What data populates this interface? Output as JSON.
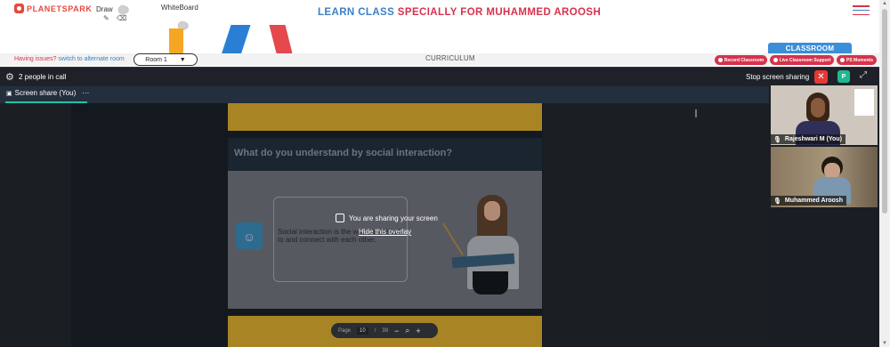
{
  "header": {
    "logo_text": "PLANETSPARK",
    "draw_label": "Draw",
    "whiteboard_label": "WhiteBoard",
    "title_part1": "LEARN CLASS",
    "title_part2": "SPECIALLY FOR MUHAMMED AROOSH"
  },
  "subbar": {
    "issues_text": "Having issues?",
    "switch_link": "switch to alternate room",
    "room_select": "Room 1",
    "curriculum": "CURRICULUM",
    "classroom_tab": "CLASSROOM",
    "pills": [
      "Record Classroom",
      "Live Classroom Support",
      "PS Moments"
    ]
  },
  "call": {
    "people_count": "2 people in call",
    "stop_sharing": "Stop screen sharing",
    "avatar_initial": "P",
    "tab_label": "Screen share (You)",
    "tab_more": "···"
  },
  "slide": {
    "question": "What do you understand by social interaction?",
    "body_text": "Social interaction is the way people talk to and connect with each other.",
    "sharing_text": "You are sharing your screen",
    "hide_overlay": "Hide this overlay",
    "pager_label": "Page",
    "page_current": "10",
    "page_sep": "/",
    "page_total": "39",
    "zoom_out": "−",
    "zoom_in": "+"
  },
  "participants": [
    {
      "name": "Rajeshwari M (You)"
    },
    {
      "name": "Muhammed Aroosh"
    }
  ],
  "colors": {
    "brand_red": "#d6324c",
    "brand_blue": "#3b7fc4",
    "share_accent": "#22c1a8",
    "stop_red": "#e53935"
  },
  "icons": [
    "pencil-icon",
    "eraser-icon",
    "gear-icon",
    "close-icon",
    "expand-icon",
    "mic-icon",
    "screen-share-icon",
    "zoom-in-icon",
    "hamburger-icon"
  ]
}
